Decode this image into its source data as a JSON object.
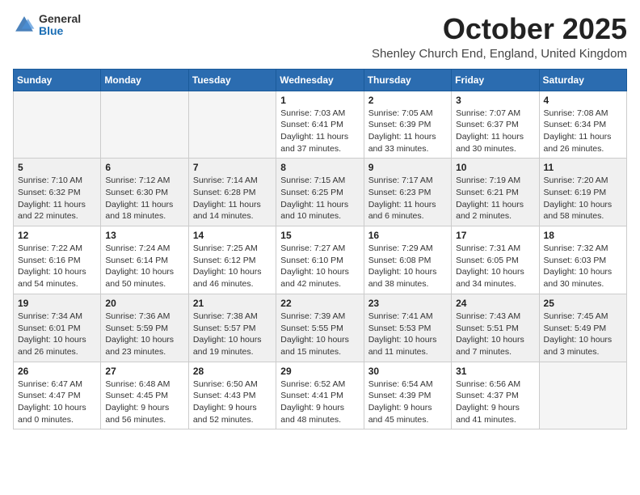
{
  "logo": {
    "text1": "General",
    "text2": "Blue"
  },
  "title": "October 2025",
  "location": "Shenley Church End, England, United Kingdom",
  "weekdays": [
    "Sunday",
    "Monday",
    "Tuesday",
    "Wednesday",
    "Thursday",
    "Friday",
    "Saturday"
  ],
  "weeks": [
    [
      {
        "day": "",
        "info": ""
      },
      {
        "day": "",
        "info": ""
      },
      {
        "day": "",
        "info": ""
      },
      {
        "day": "1",
        "info": "Sunrise: 7:03 AM\nSunset: 6:41 PM\nDaylight: 11 hours and 37 minutes."
      },
      {
        "day": "2",
        "info": "Sunrise: 7:05 AM\nSunset: 6:39 PM\nDaylight: 11 hours and 33 minutes."
      },
      {
        "day": "3",
        "info": "Sunrise: 7:07 AM\nSunset: 6:37 PM\nDaylight: 11 hours and 30 minutes."
      },
      {
        "day": "4",
        "info": "Sunrise: 7:08 AM\nSunset: 6:34 PM\nDaylight: 11 hours and 26 minutes."
      }
    ],
    [
      {
        "day": "5",
        "info": "Sunrise: 7:10 AM\nSunset: 6:32 PM\nDaylight: 11 hours and 22 minutes."
      },
      {
        "day": "6",
        "info": "Sunrise: 7:12 AM\nSunset: 6:30 PM\nDaylight: 11 hours and 18 minutes."
      },
      {
        "day": "7",
        "info": "Sunrise: 7:14 AM\nSunset: 6:28 PM\nDaylight: 11 hours and 14 minutes."
      },
      {
        "day": "8",
        "info": "Sunrise: 7:15 AM\nSunset: 6:25 PM\nDaylight: 11 hours and 10 minutes."
      },
      {
        "day": "9",
        "info": "Sunrise: 7:17 AM\nSunset: 6:23 PM\nDaylight: 11 hours and 6 minutes."
      },
      {
        "day": "10",
        "info": "Sunrise: 7:19 AM\nSunset: 6:21 PM\nDaylight: 11 hours and 2 minutes."
      },
      {
        "day": "11",
        "info": "Sunrise: 7:20 AM\nSunset: 6:19 PM\nDaylight: 10 hours and 58 minutes."
      }
    ],
    [
      {
        "day": "12",
        "info": "Sunrise: 7:22 AM\nSunset: 6:16 PM\nDaylight: 10 hours and 54 minutes."
      },
      {
        "day": "13",
        "info": "Sunrise: 7:24 AM\nSunset: 6:14 PM\nDaylight: 10 hours and 50 minutes."
      },
      {
        "day": "14",
        "info": "Sunrise: 7:25 AM\nSunset: 6:12 PM\nDaylight: 10 hours and 46 minutes."
      },
      {
        "day": "15",
        "info": "Sunrise: 7:27 AM\nSunset: 6:10 PM\nDaylight: 10 hours and 42 minutes."
      },
      {
        "day": "16",
        "info": "Sunrise: 7:29 AM\nSunset: 6:08 PM\nDaylight: 10 hours and 38 minutes."
      },
      {
        "day": "17",
        "info": "Sunrise: 7:31 AM\nSunset: 6:05 PM\nDaylight: 10 hours and 34 minutes."
      },
      {
        "day": "18",
        "info": "Sunrise: 7:32 AM\nSunset: 6:03 PM\nDaylight: 10 hours and 30 minutes."
      }
    ],
    [
      {
        "day": "19",
        "info": "Sunrise: 7:34 AM\nSunset: 6:01 PM\nDaylight: 10 hours and 26 minutes."
      },
      {
        "day": "20",
        "info": "Sunrise: 7:36 AM\nSunset: 5:59 PM\nDaylight: 10 hours and 23 minutes."
      },
      {
        "day": "21",
        "info": "Sunrise: 7:38 AM\nSunset: 5:57 PM\nDaylight: 10 hours and 19 minutes."
      },
      {
        "day": "22",
        "info": "Sunrise: 7:39 AM\nSunset: 5:55 PM\nDaylight: 10 hours and 15 minutes."
      },
      {
        "day": "23",
        "info": "Sunrise: 7:41 AM\nSunset: 5:53 PM\nDaylight: 10 hours and 11 minutes."
      },
      {
        "day": "24",
        "info": "Sunrise: 7:43 AM\nSunset: 5:51 PM\nDaylight: 10 hours and 7 minutes."
      },
      {
        "day": "25",
        "info": "Sunrise: 7:45 AM\nSunset: 5:49 PM\nDaylight: 10 hours and 3 minutes."
      }
    ],
    [
      {
        "day": "26",
        "info": "Sunrise: 6:47 AM\nSunset: 4:47 PM\nDaylight: 10 hours and 0 minutes."
      },
      {
        "day": "27",
        "info": "Sunrise: 6:48 AM\nSunset: 4:45 PM\nDaylight: 9 hours and 56 minutes."
      },
      {
        "day": "28",
        "info": "Sunrise: 6:50 AM\nSunset: 4:43 PM\nDaylight: 9 hours and 52 minutes."
      },
      {
        "day": "29",
        "info": "Sunrise: 6:52 AM\nSunset: 4:41 PM\nDaylight: 9 hours and 48 minutes."
      },
      {
        "day": "30",
        "info": "Sunrise: 6:54 AM\nSunset: 4:39 PM\nDaylight: 9 hours and 45 minutes."
      },
      {
        "day": "31",
        "info": "Sunrise: 6:56 AM\nSunset: 4:37 PM\nDaylight: 9 hours and 41 minutes."
      },
      {
        "day": "",
        "info": ""
      }
    ]
  ]
}
